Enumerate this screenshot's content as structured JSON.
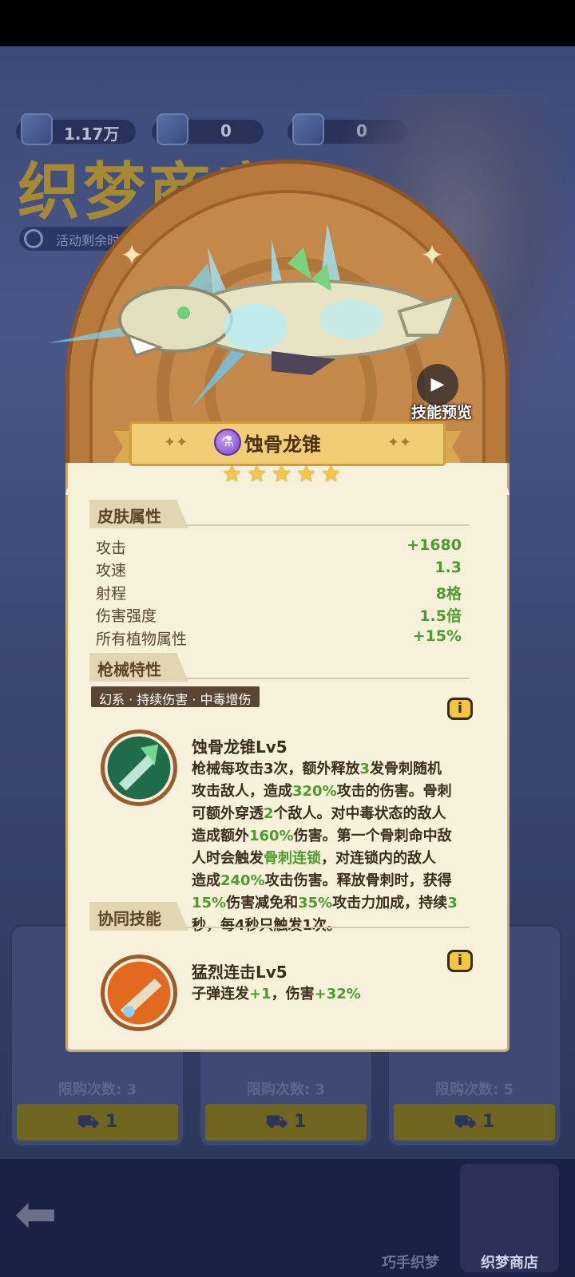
{
  "currencies": [
    {
      "name": "energy-ticket",
      "value": "1.17万"
    },
    {
      "name": "mask-ticket",
      "value": "0"
    },
    {
      "name": "envelope-ticket",
      "value": "0"
    }
  ],
  "background": {
    "shop_title": "织梦商店",
    "timer_text": "活动剩余时间",
    "cards": [
      {
        "limit": "限购次数: 3",
        "price": "1"
      },
      {
        "limit": "限购次数: 3",
        "price": "1"
      },
      {
        "limit": "限购次数: 5",
        "price": "1"
      }
    ],
    "nav": {
      "tab1": "巧手织梦",
      "tab2": "织梦商店"
    }
  },
  "modal": {
    "preview_label": "技能预览",
    "item_name": "蚀骨龙锥",
    "stars": 5,
    "skin_section": "皮肤属性",
    "stats": [
      {
        "key": "攻击",
        "value": "+1680"
      },
      {
        "key": "攻速",
        "value": "1.3"
      },
      {
        "key": "射程",
        "value": "8格"
      },
      {
        "key": "伤害强度",
        "value": "1.5倍"
      },
      {
        "key": "所有植物属性",
        "value": "+15%"
      }
    ],
    "gun_section": "枪械特性",
    "tags": "幻系 · 持续伤害 · 中毒增伤",
    "skill1": {
      "title": "蚀骨龙锥Lv5",
      "lines": [
        [
          {
            "t": "枪械每攻击3次，额外释放"
          },
          {
            "t": "3",
            "g": true
          },
          {
            "t": "发骨刺随机"
          }
        ],
        [
          {
            "t": "攻击敌人，造成"
          },
          {
            "t": "320%",
            "g": true
          },
          {
            "t": "攻击的伤害。骨刺"
          }
        ],
        [
          {
            "t": "可额外穿透"
          },
          {
            "t": "2",
            "g": true
          },
          {
            "t": "个敌人。对中毒状态的敌人"
          }
        ],
        [
          {
            "t": "造成额外"
          },
          {
            "t": "160%",
            "g": true
          },
          {
            "t": "伤害。第一个骨刺命中敌"
          }
        ],
        [
          {
            "t": "人时会触发"
          },
          {
            "t": "骨刺连锁",
            "g": true
          },
          {
            "t": "，对连锁内的敌人"
          }
        ],
        [
          {
            "t": "造成"
          },
          {
            "t": "240%",
            "g": true
          },
          {
            "t": "攻击伤害。释放骨刺时，获得"
          }
        ],
        [
          {
            "t": "15%",
            "g": true
          },
          {
            "t": "伤害减免和"
          },
          {
            "t": "35%",
            "g": true
          },
          {
            "t": "攻击力加成，持续"
          },
          {
            "t": "3",
            "g": true
          }
        ],
        [
          {
            "t": "秒，每4秒只触发1次。"
          }
        ]
      ]
    },
    "synergy_section": "协同技能",
    "skill2": {
      "title": "猛烈连击Lv5",
      "lines": [
        [
          {
            "t": "子弹连发"
          },
          {
            "t": "+1",
            "g": true
          },
          {
            "t": "，伤害"
          },
          {
            "t": "+32%",
            "g": true
          }
        ]
      ]
    },
    "info_glyph": "i"
  }
}
